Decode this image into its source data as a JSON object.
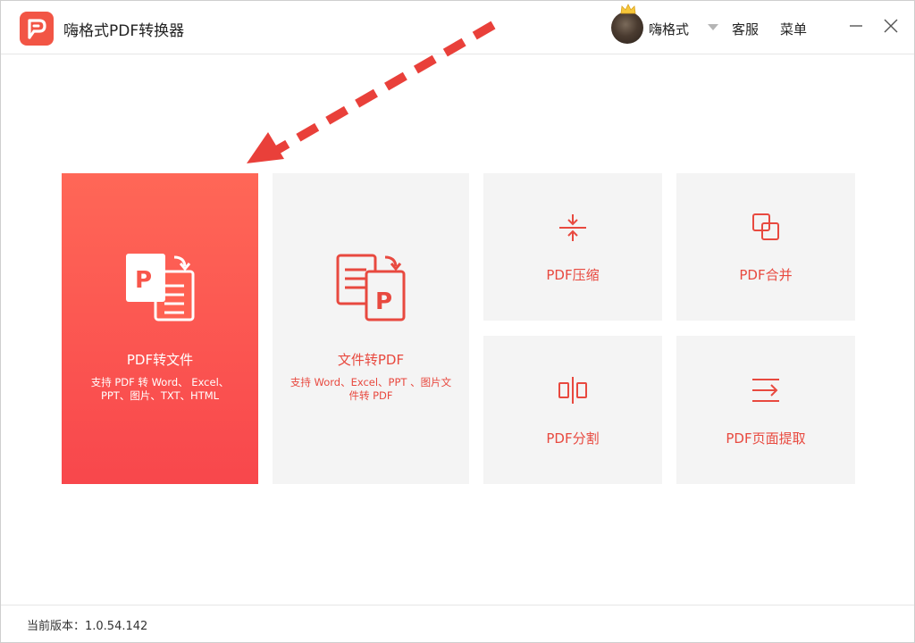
{
  "app": {
    "title": "嗨格式PDF转换器",
    "username": "嗨格式",
    "service": "客服",
    "menu": "菜单"
  },
  "colors": {
    "accent": "#f25545",
    "card_gradient_top": "#ff6757",
    "card_gradient_bottom": "#f8474c",
    "card_bg": "#f4f4f4",
    "icon_red": "#e8493f"
  },
  "cards": {
    "pdf_to_file": {
      "title": "PDF转文件",
      "desc_line1": "支持 PDF 转 Word、 Excel、",
      "desc_line2": "PPT、图片、TXT、HTML"
    },
    "file_to_pdf": {
      "title": "文件转PDF",
      "desc_line1": "支持 Word、Excel、PPT 、图片文",
      "desc_line2": "件转 PDF"
    },
    "compress": {
      "title": "PDF压缩",
      "icon": "compress-icon"
    },
    "merge": {
      "title": "PDF合并",
      "icon": "merge-icon"
    },
    "split": {
      "title": "PDF分割",
      "icon": "split-icon"
    },
    "extract": {
      "title": "PDF页面提取",
      "icon": "extract-icon"
    }
  },
  "footer": {
    "version": "当前版本：1.0.54.142"
  }
}
